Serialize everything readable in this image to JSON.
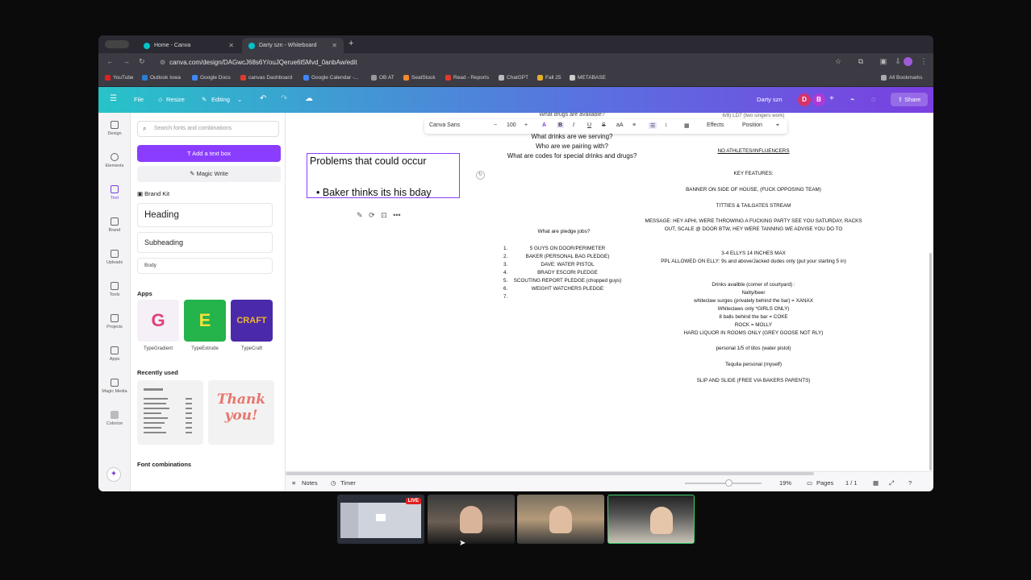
{
  "browser": {
    "tabs": [
      {
        "label": "Home - Canva"
      },
      {
        "label": "Darty szn - Whiteboard"
      }
    ],
    "url": "canva.com/design/DAGwcJ68s6Y/ouJQerue6t5Mvd_0anbAw/edit",
    "bookmarks": [
      {
        "label": "YouTube",
        "color": "#e02020"
      },
      {
        "label": "Outlook Iowa",
        "color": "#2b7cd3"
      },
      {
        "label": "Google Docs",
        "color": "#4285f4"
      },
      {
        "label": "canvas Dashboard",
        "color": "#e03b2e"
      },
      {
        "label": "Google Calendar -...",
        "color": "#4285f4"
      },
      {
        "label": "OB AT",
        "color": "#999999"
      },
      {
        "label": "SeatStock",
        "color": "#f28a2e"
      },
      {
        "label": "Read - Reports",
        "color": "#e03b2e"
      },
      {
        "label": "ChatGPT",
        "color": "#bbbbbb"
      },
      {
        "label": "Fall 25",
        "color": "#e3b02e"
      },
      {
        "label": "METABASE",
        "color": "#cccccc"
      }
    ],
    "all_bookmarks": "All Bookmarks"
  },
  "canva": {
    "header": {
      "file": "File",
      "resize": "Resize",
      "editing": "Editing",
      "title": "Darty szn",
      "share": "Share",
      "avatars": [
        "D",
        "B"
      ]
    },
    "rail": [
      {
        "label": "Design"
      },
      {
        "label": "Elements"
      },
      {
        "label": "Text"
      },
      {
        "label": "Brand"
      },
      {
        "label": "Uploads"
      },
      {
        "label": "Tools"
      },
      {
        "label": "Projects"
      },
      {
        "label": "Apps"
      },
      {
        "label": "Magic Media"
      },
      {
        "label": "Colorize"
      }
    ],
    "panel": {
      "search_placeholder": "Search fonts and combinations",
      "add_text_box": "Add a text box",
      "magic_write": "Magic Write",
      "brand_kit": "Brand Kit",
      "heading": "Heading",
      "subheading": "Subheading",
      "body": "Body",
      "apps_label": "Apps",
      "apps": [
        {
          "label": "TypeGradient",
          "glyph": "G"
        },
        {
          "label": "TypeExtrude",
          "glyph": "E"
        },
        {
          "label": "TypeCraft",
          "glyph": "CRAFT"
        }
      ],
      "recently_used": "Recently used",
      "recent_tile_2": "Thank you!",
      "font_combinations": "Font combinations"
    },
    "toolbar": {
      "font": "Canva Sans",
      "size": "100",
      "effects": "Effects",
      "position": "Position"
    },
    "page": {
      "problems_title": "Problems that could occur",
      "problems_bullet": "Baker thinks its his bday",
      "questions": [
        "What drinks are we serving?",
        "Who are we pairing with?",
        "What are codes for special drinks and drugs?"
      ],
      "pledge_title": "What are pledge jobs?",
      "pledge_jobs": [
        {
          "num": "1.",
          "text": "5 GUYS ON DOOR/PERIMETER"
        },
        {
          "num": "2.",
          "text": "BAKER (PERSONAL BAG PLEDGE)"
        },
        {
          "num": "3.",
          "text": "DAVE: WATER PISTOL"
        },
        {
          "num": "4.",
          "text": "BRADY ESCORt PLEDGE"
        },
        {
          "num": "5.",
          "text": "SCOUTING REPORT PLEDGE (chopped guys)"
        },
        {
          "num": "6.",
          "text": "WEIGHT WATCHERS PLEDGE"
        },
        {
          "num": "7.",
          "text": ""
        }
      ],
      "right_col": {
        "no_influencers": "NO ATHLETES/INFLUENCERS",
        "key_features": "KEY FEATURES:",
        "banner": "BANNER ON SIDE OF HOUSE, (FUCK OPPOSING TEAM)",
        "stream": "TITTIES & TAILGATES STREAM",
        "message": "MESSAGE: HEY APHI, WERE THROWING A FUCKING PARTY SEE YOU SATURDAY, RACKS OUT, SCALE @ DOOR BTW, HEY WERE TANNING WE ADVISE YOU DO TO",
        "ellys": "3-4 ELLYS 14 INCHES MAX",
        "ppl_allowed": "PPL ALLOWED ON ELLY: 9s and above/Jacked dudes only (put your starting 5 in)",
        "drinks_title": "Drinks availble (corner of courtyard) :",
        "drinks": [
          "Natty/beer",
          "whiteclaw surges (privately behind the bar) = XANAX",
          "Whiteclaws only *GIRLS ONLY)",
          "8 balls behind the bar = COKE",
          "ROCK = MOLLY",
          "HARD LIQUOR IN ROOMS ONLY (GREY GOOSE NOT RLY)"
        ],
        "titos": "personal 1/5 of titos (water pistol)",
        "tequila": "Tequila personal (myself)",
        "slip": "SLIP AND SLIDE (FREE VIA BAKERS PARENTS)"
      }
    },
    "bottom": {
      "notes": "Notes",
      "timer": "Timer",
      "zoom": "19%",
      "pages": "Pages",
      "page_count": "1 / 1"
    }
  },
  "call": {
    "live_badge": "LIVE"
  }
}
